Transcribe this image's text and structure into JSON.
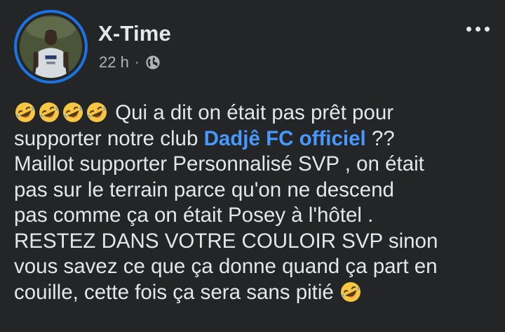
{
  "post": {
    "author": "X-Time",
    "time": "22 h",
    "separator": "·",
    "privacy_icon": "globe-icon",
    "avatar_icon": "profile-photo",
    "emoji_icon": "rolling-on-floor-laughing-emoji",
    "text": {
      "line1_suffix": " Qui a dit on était pas prêt pour",
      "line2_prefix": "supporter notre club ",
      "mention": "Dadjê FC officiel",
      "line2_suffix": " ??",
      "line3": "Maillot supporter Personnalisé SVP , on était",
      "line4": "pas sur le terrain parce qu'on ne descend",
      "line5": "pas comme ça on était Posey à l'hôtel .",
      "line6": "RESTEZ DANS VOTRE COULOIR SVP sinon",
      "line7": "vous savez ce que ça donne quand ça part en",
      "line8_prefix": "couille, cette fois ça sera sans pitié "
    }
  },
  "colors": {
    "background": "#242526",
    "text": "#e4e6eb",
    "secondary_text": "#b0b3b8",
    "mention": "#4599ff",
    "avatar_ring": "#1b74e4"
  }
}
